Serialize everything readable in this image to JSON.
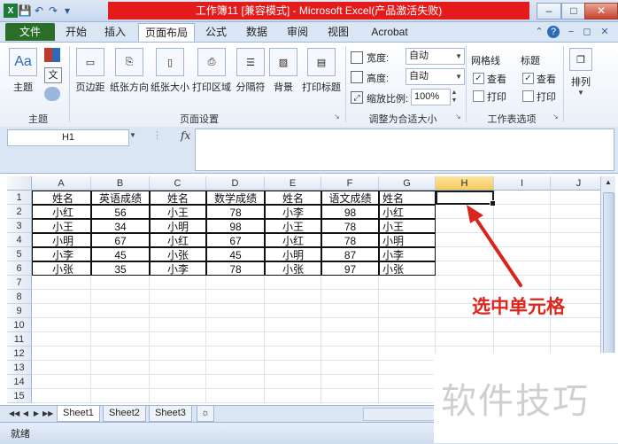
{
  "window": {
    "title": "工作簿11 [兼容模式] - Microsoft Excel(产品激活失败)",
    "controls": [
      "–",
      "□",
      "✕"
    ]
  },
  "ribbon_tabs": [
    "文件",
    "开始",
    "插入",
    "页面布局",
    "公式",
    "数据",
    "审阅",
    "视图",
    "Acrobat"
  ],
  "ribbon": {
    "theme_group": {
      "label": "主题",
      "theme_button": "主题"
    },
    "page_setup": {
      "label": "页面设置",
      "buttons": [
        "页边距",
        "纸张方向",
        "纸张大小",
        "打印区域",
        "分隔符",
        "背景",
        "打印标题"
      ]
    },
    "scale_fit": {
      "label": "调整为合适大小",
      "width_label": "宽度:",
      "width_value": "自动",
      "height_label": "高度:",
      "height_value": "自动",
      "scale_label": "缩放比例:",
      "scale_value": "100%"
    },
    "sheet_options": {
      "label": "工作表选项",
      "gridlines": "网格线",
      "headings": "标题",
      "view": "查看",
      "print": "打印"
    },
    "arrange": {
      "label": "排列"
    }
  },
  "formula_bar": {
    "name_box": "H1",
    "fx": "fx",
    "formula": ""
  },
  "columns": [
    "A",
    "B",
    "C",
    "D",
    "E",
    "F",
    "G",
    "H",
    "I",
    "J"
  ],
  "selected_column": "H",
  "rows": [
    "1",
    "2",
    "3",
    "4",
    "5",
    "6",
    "7",
    "8",
    "9",
    "10",
    "11",
    "12",
    "13",
    "14",
    "15"
  ],
  "table": [
    [
      "姓名",
      "英语成绩",
      "姓名",
      "数学成绩",
      "姓名",
      "语文成绩",
      "姓名"
    ],
    [
      "小红",
      "56",
      "小王",
      "78",
      "小李",
      "98",
      "小红"
    ],
    [
      "小王",
      "34",
      "小明",
      "98",
      "小王",
      "78",
      "小王"
    ],
    [
      "小明",
      "67",
      "小红",
      "67",
      "小红",
      "78",
      "小明"
    ],
    [
      "小李",
      "45",
      "小张",
      "45",
      "小明",
      "87",
      "小李"
    ],
    [
      "小张",
      "35",
      "小李",
      "78",
      "小张",
      "97",
      "小张"
    ]
  ],
  "sheet_tabs": [
    "Sheet1",
    "Sheet2",
    "Sheet3"
  ],
  "status": "就绪",
  "annotation": {
    "text": "选中单元格",
    "color": "#e0251c"
  },
  "watermark": "软件技巧"
}
